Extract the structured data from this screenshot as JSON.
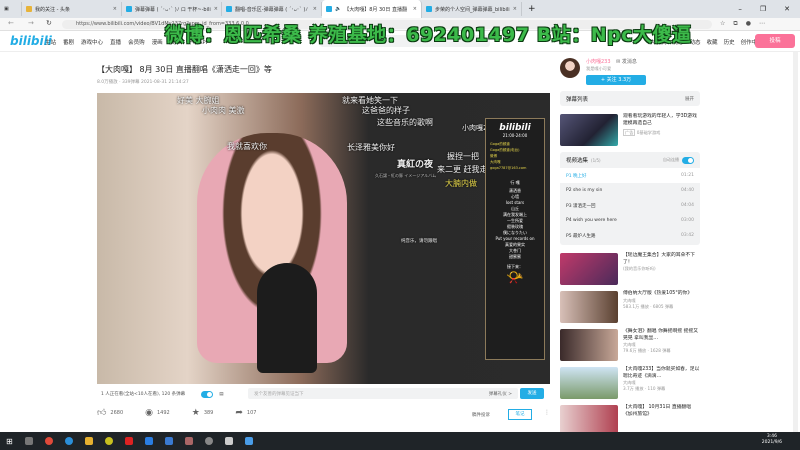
{
  "browser": {
    "tabs": [
      "我的关注 - 头条",
      "弹幕弹幕 ( ´･ᴗ･` )ﾉ ロ 干杯~-bili",
      "翻唱-音乐区-弹幕弹幕 ( ´･ᴗ･` )ﾉ",
      "【大肉嘎】8月 30日 直播翻",
      "步荣的个人空间_弹幕弹幕_bilibili"
    ],
    "url": "https://www.bilibili.com/video/BV1dMy137rg?spm_id_from=333.6.0.0"
  },
  "header": {
    "logo": "bilibili",
    "nav": [
      "主站",
      "番剧",
      "游戏中心",
      "直播",
      "会员购",
      "漫画",
      "赛事",
      "",
      "下载APP"
    ],
    "search_placeholder": "",
    "right_nav": [
      "大会员",
      "消息",
      "动态",
      "收藏",
      "历史",
      "创作中心"
    ],
    "msg_badge": "99+",
    "upload": "投稿"
  },
  "watermark": "微博：恩匹希桑 养殖基地：692401497 B站：Npc大傻逼",
  "video": {
    "title": "【大肉嘎】 8月 30日 直播翻唱《潇洒走一回》等",
    "meta": "8.0万播放 · 339弹幕   2021-08-31 21:14:27",
    "danmaku": [
      "好美 大腕姐",
      "就来看她笑一下",
      "小肉肉 美激",
      "这爸爸的样子",
      "我就喜欢你",
      "这些音乐的歌啊",
      "长泽雅美你好",
      "握捏一把",
      "来二更 赶我走",
      "大腩内做",
      "真紅の夜",
      "久石譲・紅の豚 イメージアルバム",
      "纯音乐，请勿跟唱"
    ],
    "side": {
      "name": "小肉嘎233",
      "brand": "bilibili",
      "time": "21:00-24:00",
      "contacts": [
        "Goga的频道",
        "Goga的频道(电台)",
        "微博",
        "大肉嘎",
        "goga7787@163.com"
      ],
      "songs_title": "行 嘎",
      "songs": [
        "潇洒香",
        "心墙",
        "lost stars",
        "山丘",
        "满在我发端上",
        "一生所爱",
        "假装玫瑰",
        "僕になりたい",
        "Put your records on",
        "真爱的果实",
        "大苍门",
        "甜蜜蜜"
      ],
      "footer": "接下来："
    }
  },
  "danmaku_bar": {
    "status": "1 人正在看(全站<10人在看), 120 条弹幕",
    "placeholder": "发个友善的弹幕见证当下",
    "etiquette": "弹幕礼仪 >",
    "send": "发送"
  },
  "actions": {
    "like": "2680",
    "coin": "1492",
    "fav": "389",
    "share": "107",
    "report": "稿件投诉",
    "note": "笔记"
  },
  "uploader": {
    "name": "小肉嘎233",
    "message": "发消息",
    "sign": "我是嘎小可爱",
    "follow": "+ 关注 3.3万"
  },
  "danmaku_list": {
    "title": "弹幕列表",
    "expand": "展开"
  },
  "ad": {
    "text": "观看看玩游戏的年轻人，学3D游戏建模再造自己",
    "tag": "广告",
    "sub": "0基础学游戏"
  },
  "playlist": {
    "title": "视频选集",
    "count": "(1/5)",
    "autoplay": "自动连播",
    "episodes": [
      {
        "p": "P1",
        "name": "晚上好",
        "dur": "01:21"
      },
      {
        "p": "P2",
        "name": "she is my sin",
        "dur": "04:40"
      },
      {
        "p": "P3",
        "name": "潇洒走一回",
        "dur": "04:04"
      },
      {
        "p": "P4",
        "name": "wish you were here",
        "dur": "03:00"
      },
      {
        "p": "P5",
        "name": "最炉人生路",
        "dur": "03:42"
      }
    ]
  },
  "recommendations": [
    {
      "title": "【瑶边魔王集合】大家的耳朵不下了！",
      "sub": "(我的音乐你听吗)",
      "stats": ""
    },
    {
      "title": "傅伯纳大厅版《热爱105°的你》",
      "sub": "大肉嘎",
      "stats": "583.1万 播放 · 6805 弹幕"
    },
    {
      "title": "《舞女泪》翻唱 你舞摇啊摇 摇摇又晃晃 拿叫我显…",
      "sub": "大肉嘎",
      "stats": "79.6万 播放 · 1628 弹幕"
    },
    {
      "title": "【大肉嘎233】当你就买如春，足以嗯比奇迹《滴滴…",
      "sub": "大肉嘎",
      "stats": "3.7万 播放 · 110 弹幕"
    },
    {
      "title": "【大肉嘎】 10月31日 直播翻唱《加州旅馆》",
      "sub": "",
      "stats": ""
    }
  ],
  "clock": {
    "time": "3:46",
    "date": "2021/9/6"
  },
  "colors": {
    "accent": "#23ade5",
    "pink": "#fb7299",
    "watermark": "#3cba4a"
  }
}
